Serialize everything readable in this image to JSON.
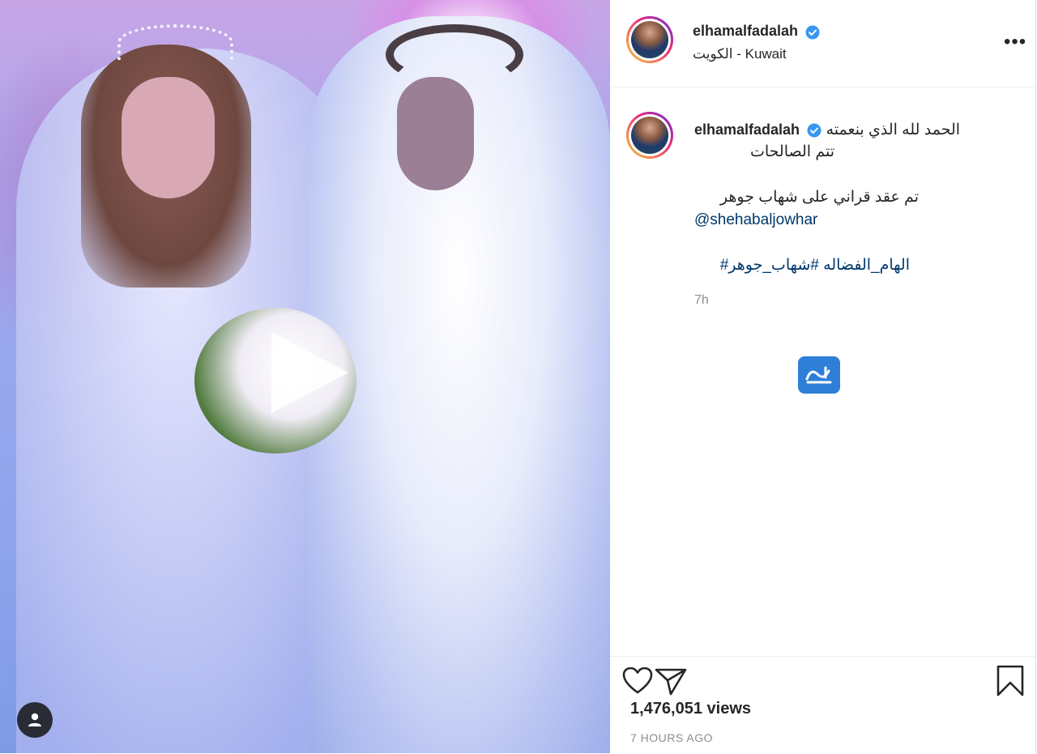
{
  "post": {
    "username": "elhamalfadalah",
    "location": "الكويت - Kuwait",
    "more_icon": "more-horizontal-icon"
  },
  "caption": {
    "username": "elhamalfadalah",
    "line1": "الحمد لله الذي بنعمته",
    "line2": "تتم الصالحات",
    "line3": "تم عقد قراني على شهاب جوهر",
    "mention": "@shehabaljowhar",
    "hashtags": "الهام_الفضاله #شهاب_جوهر#",
    "time": "7h"
  },
  "footer": {
    "views": "1,476,051 views",
    "time_ago": "7 HOURS AGO"
  },
  "icons": {
    "like": "heart-icon",
    "share": "send-icon",
    "save": "bookmark-icon",
    "play": "play-icon",
    "user_tag": "user-icon",
    "verified": "verified-badge-icon"
  },
  "colors": {
    "link": "#00376b",
    "verified": "#3897f0",
    "text": "#262626",
    "muted": "#8e8e8e"
  }
}
